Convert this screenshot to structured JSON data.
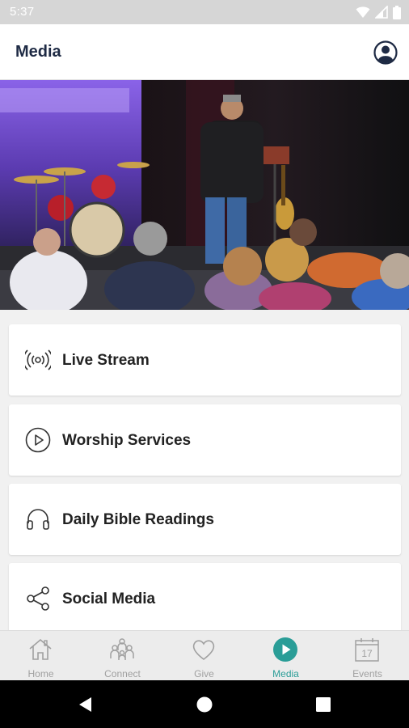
{
  "status_bar": {
    "time": "5:37"
  },
  "header": {
    "title": "Media"
  },
  "menu": {
    "items": [
      {
        "label": "Live Stream",
        "icon": "broadcast-icon"
      },
      {
        "label": "Worship Services",
        "icon": "play-circle-icon"
      },
      {
        "label": "Daily Bible Readings",
        "icon": "headphones-icon"
      },
      {
        "label": "Social Media",
        "icon": "share-icon"
      }
    ]
  },
  "tabs": {
    "items": [
      {
        "label": "Home",
        "icon": "home-icon",
        "active": false
      },
      {
        "label": "Connect",
        "icon": "people-icon",
        "active": false
      },
      {
        "label": "Give",
        "icon": "heart-icon",
        "active": false
      },
      {
        "label": "Media",
        "icon": "play-icon",
        "active": true
      },
      {
        "label": "Events",
        "icon": "calendar-icon",
        "active": false
      }
    ],
    "calendar_day": "17"
  },
  "colors": {
    "accent": "#2a9d97",
    "title": "#1e2a44",
    "inactive": "#a0a0a0"
  }
}
